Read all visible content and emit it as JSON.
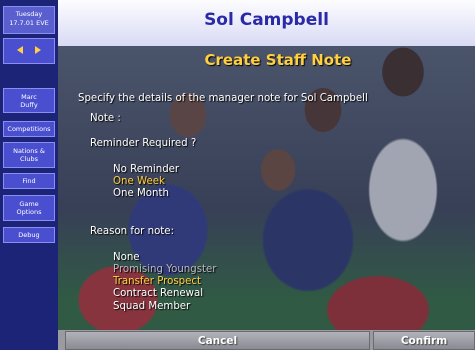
{
  "sidebar": {
    "date_day": "Tuesday",
    "date_full": "17.7.01 EVE",
    "manager": "Marc Duffy",
    "buttons": [
      {
        "label": "Competitions"
      },
      {
        "label": "Nations & Clubs"
      },
      {
        "label": "Find"
      },
      {
        "label": "Game Options"
      },
      {
        "label": "Debug"
      }
    ]
  },
  "header": {
    "title": "Sol Campbell",
    "subtitle": "Create Staff Note"
  },
  "form": {
    "instruction": "Specify the details of the manager note for Sol Campbell",
    "note_label": "Note :",
    "reminder_label": "Reminder Required ?",
    "reminder_options": [
      {
        "label": "No Reminder",
        "state": "normal"
      },
      {
        "label": "One Week",
        "state": "selected"
      },
      {
        "label": "One Month",
        "state": "normal"
      }
    ],
    "reason_label": "Reason for note:",
    "reason_options": [
      {
        "label": "None",
        "state": "normal"
      },
      {
        "label": "Promising Youngster",
        "state": "disabled"
      },
      {
        "label": "Transfer Prospect",
        "state": "selected"
      },
      {
        "label": "Contract Renewal",
        "state": "normal"
      },
      {
        "label": "Squad Member",
        "state": "normal"
      }
    ]
  },
  "actions": {
    "cancel": "Cancel",
    "confirm": "Confirm"
  },
  "colors": {
    "sidebar": "#1c2478",
    "selected": "#ffd040",
    "title": "#2a2aa8"
  }
}
